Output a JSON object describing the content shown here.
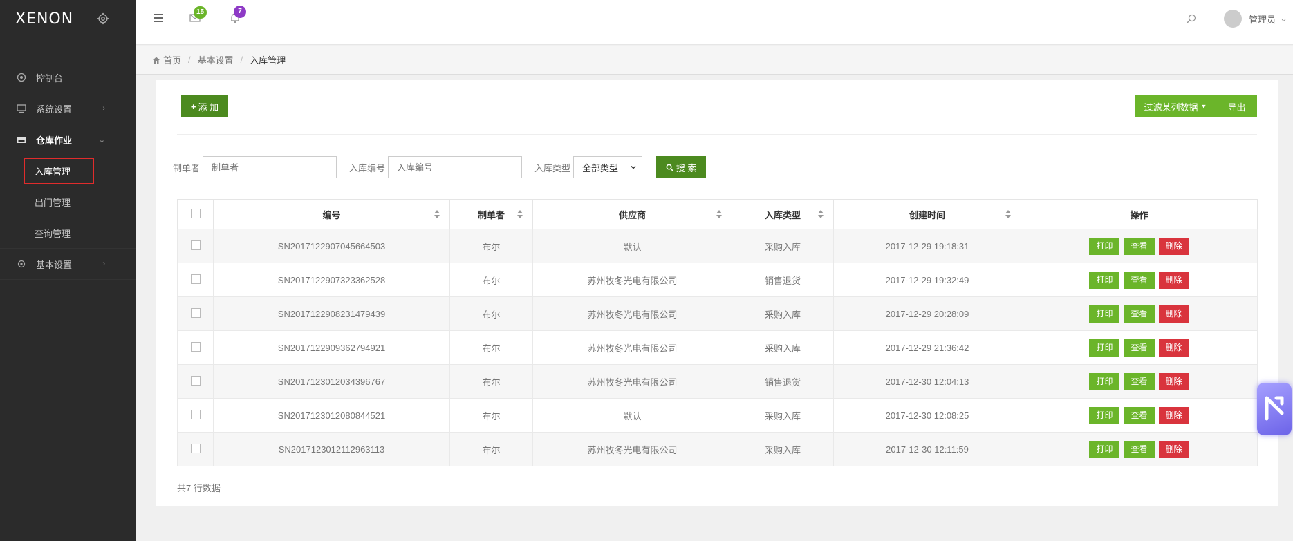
{
  "app": {
    "logo": "XENON"
  },
  "sidebar": {
    "items": [
      {
        "label": "控制台"
      },
      {
        "label": "系统设置"
      },
      {
        "label": "仓库作业"
      },
      {
        "label": "基本设置"
      }
    ],
    "subitems": [
      {
        "label": "入库管理"
      },
      {
        "label": "出门管理"
      },
      {
        "label": "查询管理"
      }
    ]
  },
  "header": {
    "mail_count": "15",
    "bell_count": "7",
    "user": "管理员",
    "colors": {
      "mail_badge": "#6bb52a",
      "bell_badge": "#8e3ac6"
    }
  },
  "breadcrumb": {
    "home": "首页",
    "level2": "基本设置",
    "current": "入库管理"
  },
  "toolbar": {
    "add": "添 加",
    "filter": "过滤某列数据",
    "export": "导出"
  },
  "search": {
    "creator_label": "制单者",
    "creator_placeholder": "制单者",
    "code_label": "入库编号",
    "code_placeholder": "入库编号",
    "type_label": "入库类型",
    "type_value": "全部类型",
    "button": "搜 索"
  },
  "table": {
    "headers": [
      "编号",
      "制单者",
      "供应商",
      "入库类型",
      "创建时间",
      "操作"
    ],
    "rows": [
      {
        "code": "SN2017122907045664503",
        "creator": "布尔",
        "supplier": "默认",
        "type": "采购入库",
        "time": "2017-12-29 19:18:31"
      },
      {
        "code": "SN2017122907323362528",
        "creator": "布尔",
        "supplier": "苏州牧冬光电有限公司",
        "type": "销售退货",
        "time": "2017-12-29 19:32:49"
      },
      {
        "code": "SN2017122908231479439",
        "creator": "布尔",
        "supplier": "苏州牧冬光电有限公司",
        "type": "采购入库",
        "time": "2017-12-29 20:28:09"
      },
      {
        "code": "SN2017122909362794921",
        "creator": "布尔",
        "supplier": "苏州牧冬光电有限公司",
        "type": "采购入库",
        "time": "2017-12-29 21:36:42"
      },
      {
        "code": "SN2017123012034396767",
        "creator": "布尔",
        "supplier": "苏州牧冬光电有限公司",
        "type": "销售退货",
        "time": "2017-12-30 12:04:13"
      },
      {
        "code": "SN2017123012080844521",
        "creator": "布尔",
        "supplier": "默认",
        "type": "采购入库",
        "time": "2017-12-30 12:08:25"
      },
      {
        "code": "SN2017123012112963113",
        "creator": "布尔",
        "supplier": "苏州牧冬光电有限公司",
        "type": "采购入库",
        "time": "2017-12-30 12:11:59"
      }
    ],
    "actions": {
      "print": "打印",
      "view": "查看",
      "delete": "删除"
    }
  },
  "footer": {
    "count": "共7 行数据"
  }
}
